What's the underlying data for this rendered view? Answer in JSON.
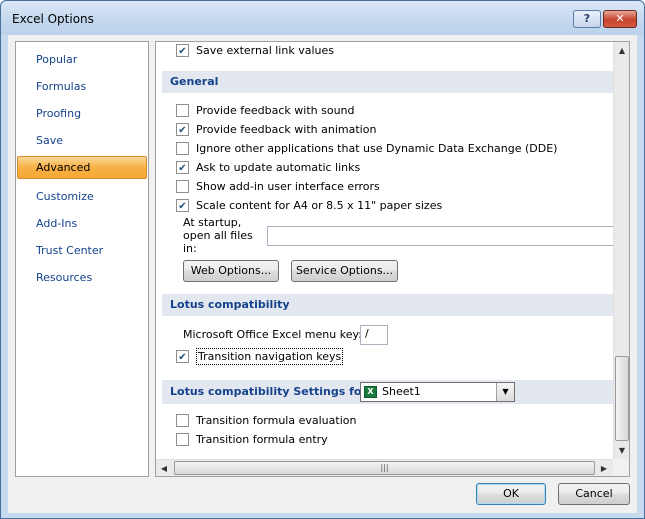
{
  "window": {
    "title": "Excel Options",
    "help_label": "?",
    "close_label": "✕"
  },
  "nav": {
    "items": [
      {
        "label": "Popular"
      },
      {
        "label": "Formulas"
      },
      {
        "label": "Proofing"
      },
      {
        "label": "Save"
      },
      {
        "label": "Advanced",
        "selected": true
      },
      {
        "label": "Customize"
      },
      {
        "label": "Add-Ins"
      },
      {
        "label": "Trust Center"
      },
      {
        "label": "Resources"
      }
    ]
  },
  "content": {
    "top_option": {
      "label": "Save external link values",
      "checked": true
    },
    "general": {
      "header": "General",
      "options": [
        {
          "label": "Provide feedback with sound",
          "checked": false
        },
        {
          "label": "Provide feedback with animation",
          "checked": true
        },
        {
          "label": "Ignore other applications that use Dynamic Data Exchange (DDE)",
          "checked": false
        },
        {
          "label": "Ask to update automatic links",
          "checked": true
        },
        {
          "label": "Show add-in user interface errors",
          "checked": false
        },
        {
          "label": "Scale content for A4 or 8.5 x 11\" paper sizes",
          "checked": true
        }
      ],
      "startup_label_1": "At startup,",
      "startup_label_2": "open all files",
      "startup_label_3": "in:",
      "startup_value": "",
      "web_options_label": "Web Options...",
      "service_options_label": "Service Options..."
    },
    "lotus": {
      "header": "Lotus compatibility",
      "menu_key_label": "Microsoft Office Excel menu key:",
      "menu_key_value": "/",
      "transition_nav": {
        "label": "Transition navigation keys",
        "checked": true
      }
    },
    "lotus_settings": {
      "header": "Lotus compatibility Settings for:",
      "sheet_value": "Sheet1",
      "options": [
        {
          "label": "Transition formula evaluation",
          "checked": false
        },
        {
          "label": "Transition formula entry",
          "checked": false
        }
      ]
    }
  },
  "scrollbars": {
    "up": "▲",
    "down": "▼",
    "left": "◀",
    "right": "▶",
    "hgrip": "|||"
  },
  "footer": {
    "ok_label": "OK",
    "cancel_label": "Cancel"
  }
}
